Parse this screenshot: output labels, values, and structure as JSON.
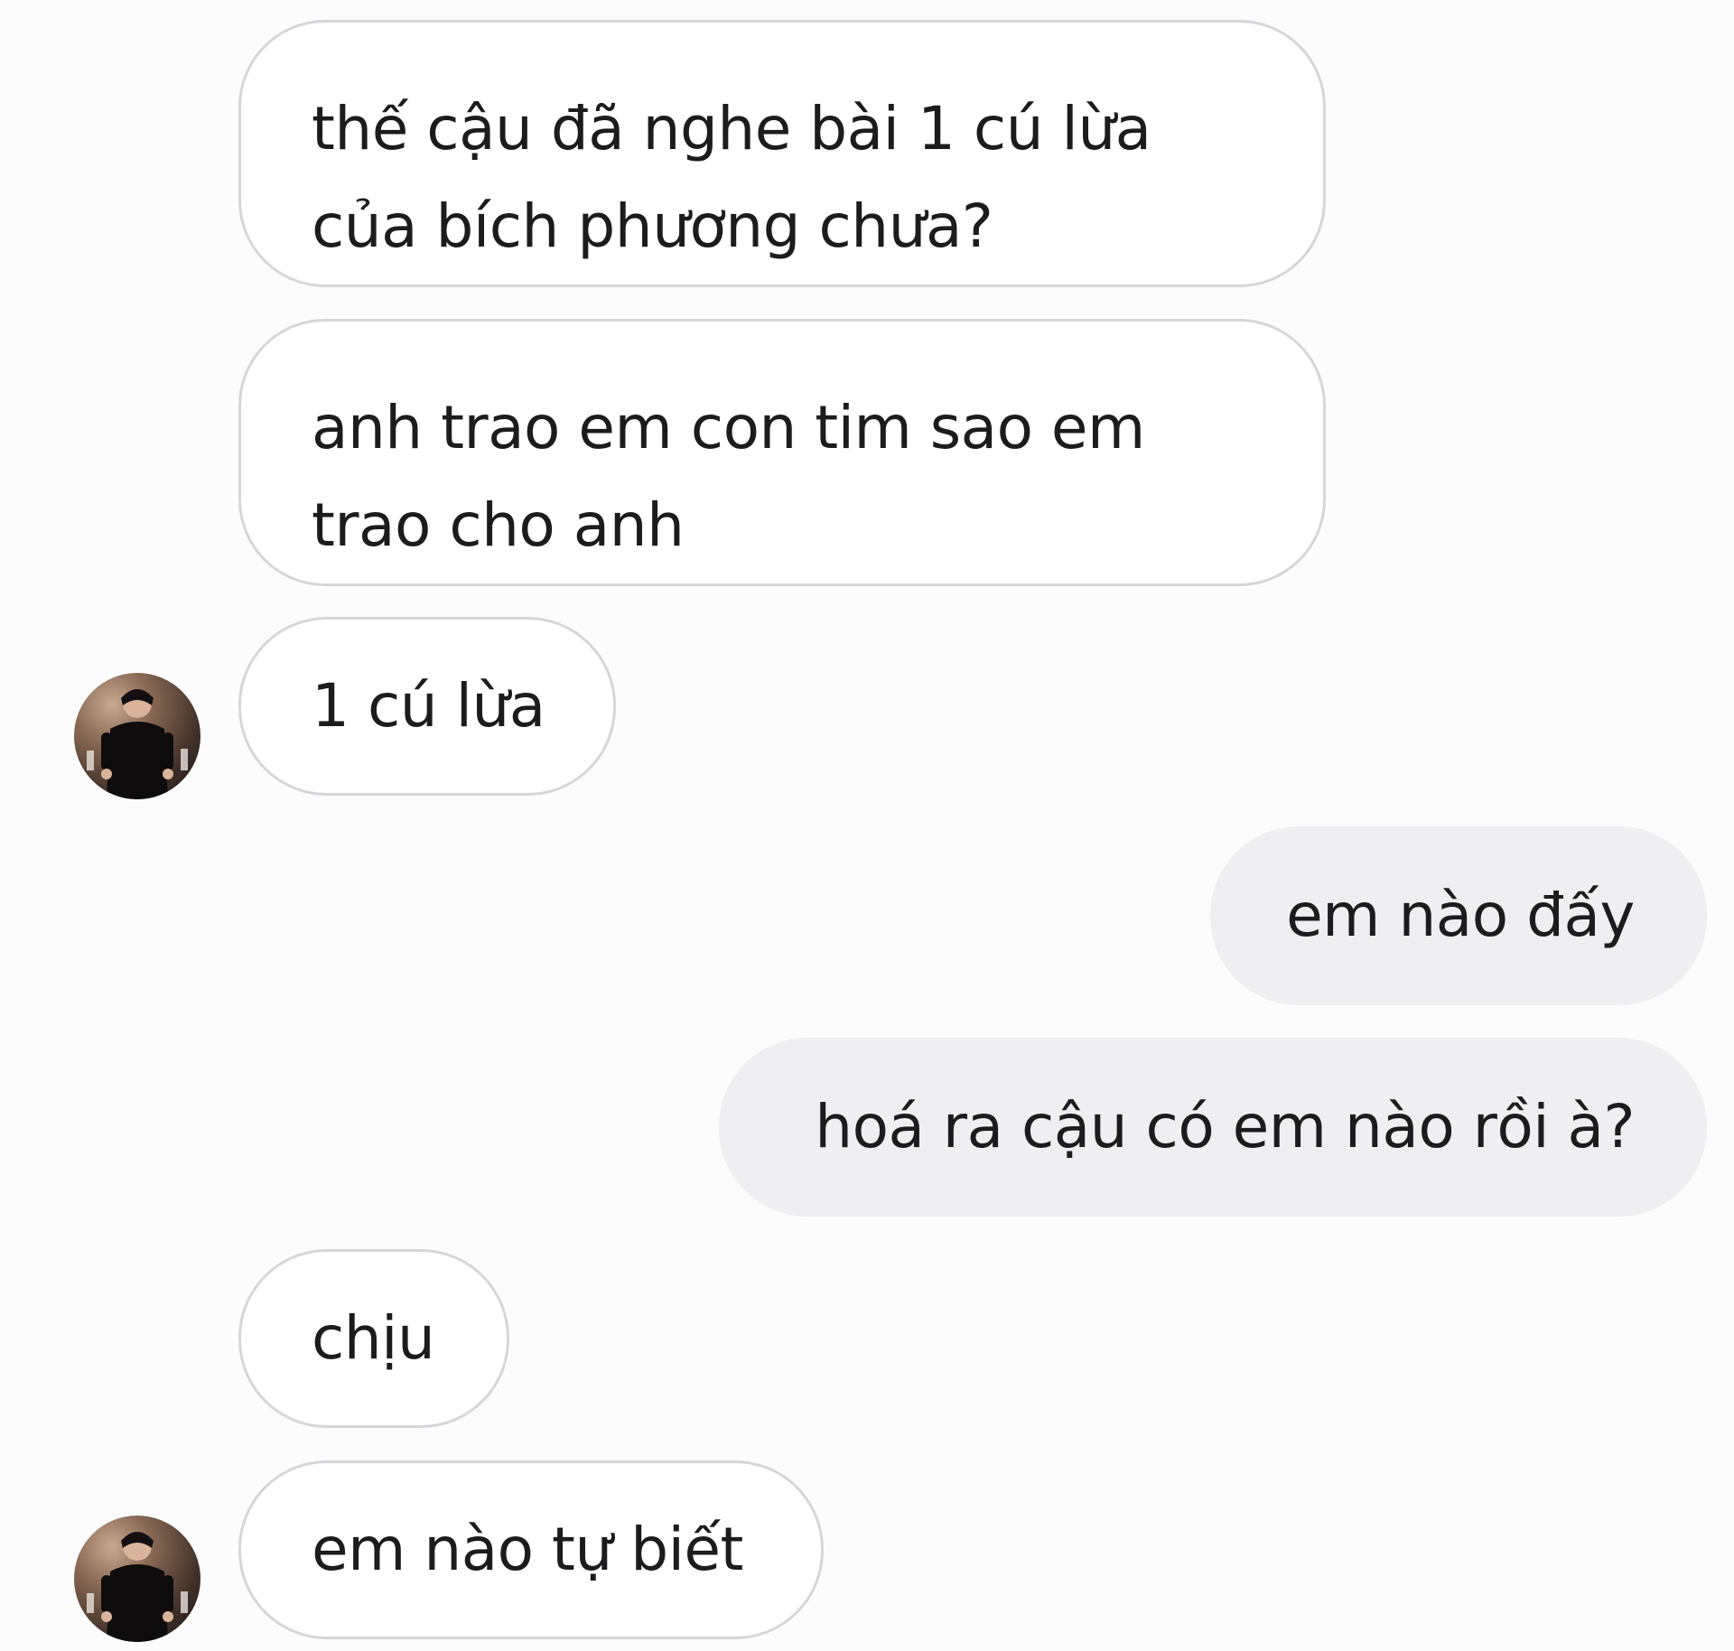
{
  "messages": [
    {
      "sender": "them",
      "lines": [
        "thế cậu đã nghe bài 1 cú lừa",
        "của bích phương chưa?"
      ]
    },
    {
      "sender": "them",
      "lines": [
        "anh trao em con tim sao em",
        "trao cho anh"
      ]
    },
    {
      "sender": "them",
      "lines": [
        "1 cú lừa"
      ]
    },
    {
      "sender": "me",
      "lines": [
        "em nào đấy"
      ]
    },
    {
      "sender": "me",
      "lines": [
        "hoá ra cậu có em nào rồi à?"
      ]
    },
    {
      "sender": "them",
      "lines": [
        "chịu"
      ]
    },
    {
      "sender": "them",
      "lines": [
        "em nào tự biết"
      ]
    }
  ],
  "colors": {
    "background": "#fcfcfd",
    "incoming_bubble": "#ffffff",
    "incoming_border": "#d6d6da",
    "outgoing_bubble": "#efeff1",
    "text": "#1c1c1e"
  },
  "icons": {
    "avatar": "contact-avatar-photo"
  }
}
